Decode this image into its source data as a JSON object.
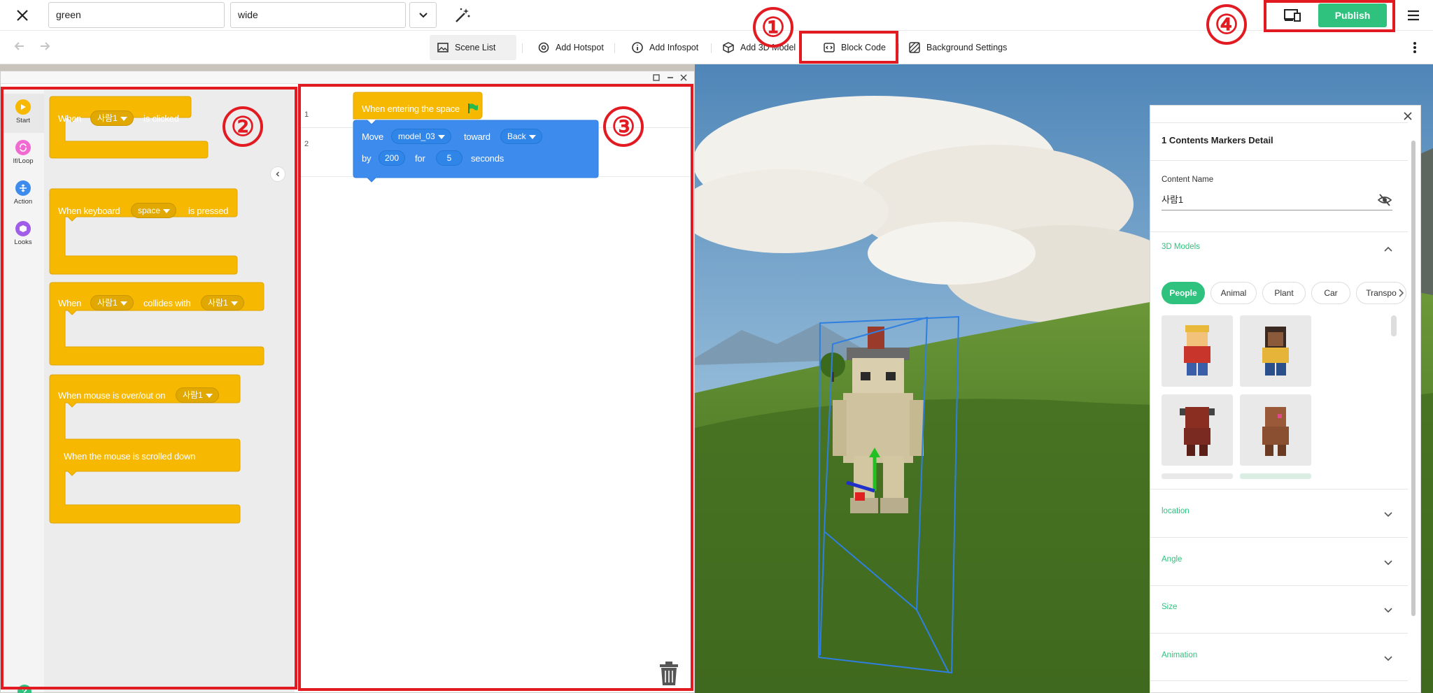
{
  "topbar": {
    "field1_value": "green",
    "field2_value": "wide",
    "publish_label": "Publish",
    "accent": "#2ec27e"
  },
  "toolbar": {
    "items": [
      {
        "label": "Scene List",
        "icon": "image-icon"
      },
      {
        "label": "Add Hotspot",
        "icon": "target-icon"
      },
      {
        "label": "Add Infospot",
        "icon": "info-icon"
      },
      {
        "label": "Add 3D Model",
        "icon": "cube-icon"
      },
      {
        "label": "Block Code",
        "icon": "code-icon"
      },
      {
        "label": "Background Settings",
        "icon": "hatch-icon"
      }
    ]
  },
  "categories": [
    {
      "label": "Start",
      "color": "#f6b800"
    },
    {
      "label": "If/Loop",
      "color": "#f06ad1"
    },
    {
      "label": "Action",
      "color": "#3d8bec"
    },
    {
      "label": "Looks",
      "color": "#a05ee8"
    }
  ],
  "palette": {
    "b1_when": "When",
    "b1_target": "사람1",
    "b1_suffix": "is clicked",
    "b2_prefix": "When keyboard",
    "b2_key": "space",
    "b2_suffix": "is pressed",
    "b3_when": "When",
    "b3_target": "사람1",
    "b3_mid": "collides with",
    "b3_other": "사람1",
    "b4_prefix": "When mouse is over/out on",
    "b4_target": "사람1",
    "b5_text": "When the mouse is scrolled down"
  },
  "workspace": {
    "row1": "1",
    "row2": "2",
    "hat_text": "When entering the space",
    "move_label": "Move",
    "move_model": "model_03",
    "toward_label": "toward",
    "direction": "Back",
    "by_label": "by",
    "distance": "200",
    "for_label": "for",
    "duration": "5",
    "seconds_label": "seconds"
  },
  "detail": {
    "title": "1 Contents Markers Detail",
    "content_name_label": "Content Name",
    "content_name_value": "사람1",
    "models_header": "3D Models",
    "chips": [
      "People",
      "Animal",
      "Plant",
      "Car",
      "Transpo"
    ],
    "sections": [
      "location",
      "Angle",
      "Size",
      "Animation"
    ]
  },
  "annotations": [
    "①",
    "②",
    "③",
    "④"
  ]
}
